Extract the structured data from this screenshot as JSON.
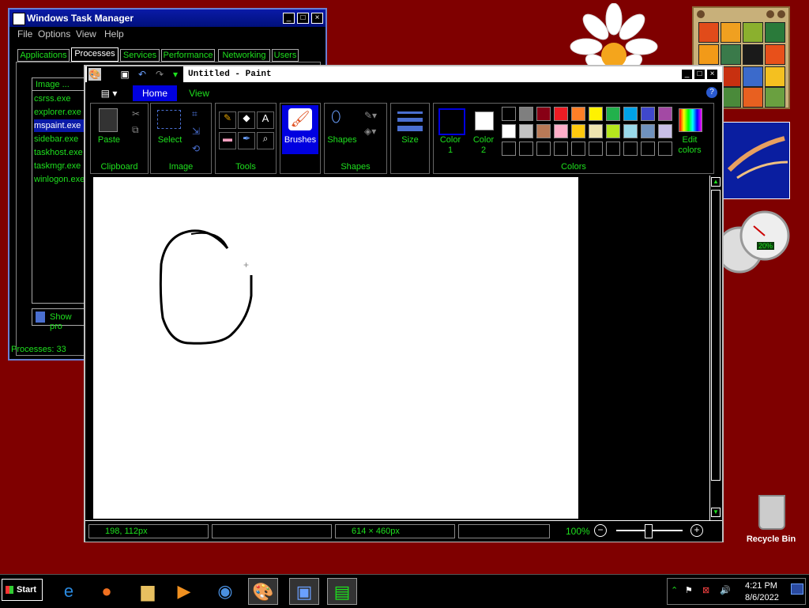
{
  "task_manager": {
    "title": "Windows Task Manager",
    "menu": [
      "File",
      "Options",
      "View",
      "Help"
    ],
    "tabs": [
      "Applications",
      "Processes",
      "Services",
      "Performance",
      "Networking",
      "Users"
    ],
    "column_header": "Image ...",
    "processes": [
      "csrss.exe",
      "explorer.exe",
      "mspaint.exe",
      "sidebar.exe",
      "taskhost.exe",
      "taskmgr.exe",
      "winlogon.exe"
    ],
    "selected_process": "mspaint.exe",
    "show_button": "Show pro",
    "status": "Processes: 33"
  },
  "paint": {
    "title": "Untitled - Paint",
    "tabs": [
      "Home",
      "View"
    ],
    "groups": {
      "clipboard": "Clipboard",
      "image": "Image",
      "tools": "Tools",
      "shapes": "Shapes",
      "colors": "Colors"
    },
    "buttons": {
      "paste": "Paste",
      "select": "Select",
      "brushes": "Brushes",
      "shapes": "Shapes",
      "size": "Size",
      "color1_a": "Color",
      "color1_b": "1",
      "color2_a": "Color",
      "color2_b": "2",
      "edit_colors_a": "Edit",
      "edit_colors_b": "colors"
    },
    "palette_row1": [
      "#000000",
      "#7f7f7f",
      "#880015",
      "#ed1c24",
      "#ff7f27",
      "#fff200",
      "#22b14c",
      "#00a2e8",
      "#3f48cc",
      "#a349a4"
    ],
    "palette_row2": [
      "#ffffff",
      "#c3c3c3",
      "#b97a57",
      "#ffaec9",
      "#ffc90e",
      "#efe4b0",
      "#b5e61d",
      "#99d9ea",
      "#7092be",
      "#c8bfe7"
    ],
    "status": {
      "cursor_pos": "198, 112px",
      "canvas_size": "614 × 460px",
      "zoom": "100%"
    }
  },
  "desktop": {
    "recycle_bin": "Recycle Bin",
    "gadget_meter": "20%"
  },
  "taskbar": {
    "start": "Start",
    "clock_time": "4:21 PM",
    "clock_date": "8/6/2022"
  }
}
